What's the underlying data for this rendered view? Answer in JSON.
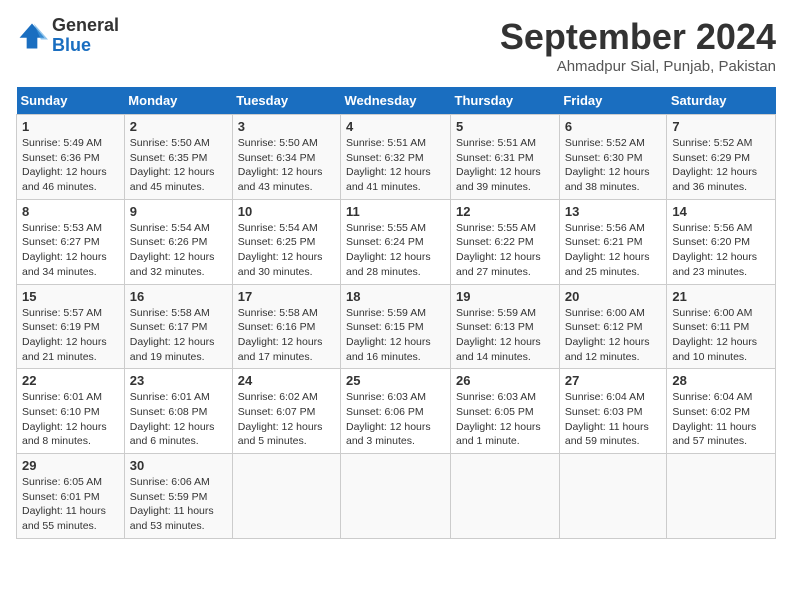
{
  "header": {
    "logo_general": "General",
    "logo_blue": "Blue",
    "month_title": "September 2024",
    "location": "Ahmadpur Sial, Punjab, Pakistan"
  },
  "days_of_week": [
    "Sunday",
    "Monday",
    "Tuesday",
    "Wednesday",
    "Thursday",
    "Friday",
    "Saturday"
  ],
  "weeks": [
    [
      {
        "day": "1",
        "detail": "Sunrise: 5:49 AM\nSunset: 6:36 PM\nDaylight: 12 hours\nand 46 minutes."
      },
      {
        "day": "2",
        "detail": "Sunrise: 5:50 AM\nSunset: 6:35 PM\nDaylight: 12 hours\nand 45 minutes."
      },
      {
        "day": "3",
        "detail": "Sunrise: 5:50 AM\nSunset: 6:34 PM\nDaylight: 12 hours\nand 43 minutes."
      },
      {
        "day": "4",
        "detail": "Sunrise: 5:51 AM\nSunset: 6:32 PM\nDaylight: 12 hours\nand 41 minutes."
      },
      {
        "day": "5",
        "detail": "Sunrise: 5:51 AM\nSunset: 6:31 PM\nDaylight: 12 hours\nand 39 minutes."
      },
      {
        "day": "6",
        "detail": "Sunrise: 5:52 AM\nSunset: 6:30 PM\nDaylight: 12 hours\nand 38 minutes."
      },
      {
        "day": "7",
        "detail": "Sunrise: 5:52 AM\nSunset: 6:29 PM\nDaylight: 12 hours\nand 36 minutes."
      }
    ],
    [
      {
        "day": "8",
        "detail": "Sunrise: 5:53 AM\nSunset: 6:27 PM\nDaylight: 12 hours\nand 34 minutes."
      },
      {
        "day": "9",
        "detail": "Sunrise: 5:54 AM\nSunset: 6:26 PM\nDaylight: 12 hours\nand 32 minutes."
      },
      {
        "day": "10",
        "detail": "Sunrise: 5:54 AM\nSunset: 6:25 PM\nDaylight: 12 hours\nand 30 minutes."
      },
      {
        "day": "11",
        "detail": "Sunrise: 5:55 AM\nSunset: 6:24 PM\nDaylight: 12 hours\nand 28 minutes."
      },
      {
        "day": "12",
        "detail": "Sunrise: 5:55 AM\nSunset: 6:22 PM\nDaylight: 12 hours\nand 27 minutes."
      },
      {
        "day": "13",
        "detail": "Sunrise: 5:56 AM\nSunset: 6:21 PM\nDaylight: 12 hours\nand 25 minutes."
      },
      {
        "day": "14",
        "detail": "Sunrise: 5:56 AM\nSunset: 6:20 PM\nDaylight: 12 hours\nand 23 minutes."
      }
    ],
    [
      {
        "day": "15",
        "detail": "Sunrise: 5:57 AM\nSunset: 6:19 PM\nDaylight: 12 hours\nand 21 minutes."
      },
      {
        "day": "16",
        "detail": "Sunrise: 5:58 AM\nSunset: 6:17 PM\nDaylight: 12 hours\nand 19 minutes."
      },
      {
        "day": "17",
        "detail": "Sunrise: 5:58 AM\nSunset: 6:16 PM\nDaylight: 12 hours\nand 17 minutes."
      },
      {
        "day": "18",
        "detail": "Sunrise: 5:59 AM\nSunset: 6:15 PM\nDaylight: 12 hours\nand 16 minutes."
      },
      {
        "day": "19",
        "detail": "Sunrise: 5:59 AM\nSunset: 6:13 PM\nDaylight: 12 hours\nand 14 minutes."
      },
      {
        "day": "20",
        "detail": "Sunrise: 6:00 AM\nSunset: 6:12 PM\nDaylight: 12 hours\nand 12 minutes."
      },
      {
        "day": "21",
        "detail": "Sunrise: 6:00 AM\nSunset: 6:11 PM\nDaylight: 12 hours\nand 10 minutes."
      }
    ],
    [
      {
        "day": "22",
        "detail": "Sunrise: 6:01 AM\nSunset: 6:10 PM\nDaylight: 12 hours\nand 8 minutes."
      },
      {
        "day": "23",
        "detail": "Sunrise: 6:01 AM\nSunset: 6:08 PM\nDaylight: 12 hours\nand 6 minutes."
      },
      {
        "day": "24",
        "detail": "Sunrise: 6:02 AM\nSunset: 6:07 PM\nDaylight: 12 hours\nand 5 minutes."
      },
      {
        "day": "25",
        "detail": "Sunrise: 6:03 AM\nSunset: 6:06 PM\nDaylight: 12 hours\nand 3 minutes."
      },
      {
        "day": "26",
        "detail": "Sunrise: 6:03 AM\nSunset: 6:05 PM\nDaylight: 12 hours\nand 1 minute."
      },
      {
        "day": "27",
        "detail": "Sunrise: 6:04 AM\nSunset: 6:03 PM\nDaylight: 11 hours\nand 59 minutes."
      },
      {
        "day": "28",
        "detail": "Sunrise: 6:04 AM\nSunset: 6:02 PM\nDaylight: 11 hours\nand 57 minutes."
      }
    ],
    [
      {
        "day": "29",
        "detail": "Sunrise: 6:05 AM\nSunset: 6:01 PM\nDaylight: 11 hours\nand 55 minutes."
      },
      {
        "day": "30",
        "detail": "Sunrise: 6:06 AM\nSunset: 5:59 PM\nDaylight: 11 hours\nand 53 minutes."
      },
      {
        "day": "",
        "detail": ""
      },
      {
        "day": "",
        "detail": ""
      },
      {
        "day": "",
        "detail": ""
      },
      {
        "day": "",
        "detail": ""
      },
      {
        "day": "",
        "detail": ""
      }
    ]
  ]
}
